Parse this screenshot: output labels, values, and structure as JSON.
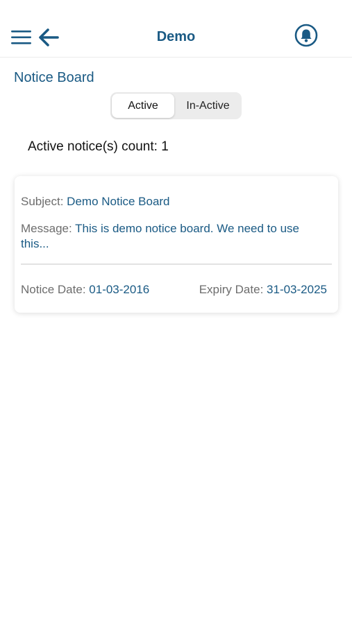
{
  "header": {
    "title": "Demo",
    "icons": [
      "menu-icon",
      "back-arrow-icon",
      "bell-icon"
    ],
    "accent_color": "#1a5a84"
  },
  "page": {
    "title": "Notice Board"
  },
  "tabs": {
    "active_label": "Active",
    "inactive_label": "In-Active",
    "selected": "Active"
  },
  "count": {
    "text": "Active notice(s) count: 1"
  },
  "notices": [
    {
      "subject_label": "Subject:",
      "subject": "Demo Notice Board",
      "message_label": "Message:",
      "message": "This is demo notice board. We need to use this...",
      "notice_date_label": "Notice Date:",
      "notice_date": "01-03-2016",
      "expiry_date_label": "Expiry Date:",
      "expiry_date": "31-03-2025"
    }
  ]
}
